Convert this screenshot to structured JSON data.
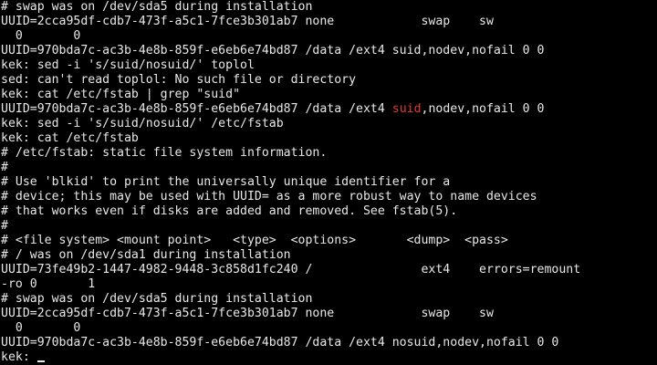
{
  "terminal": {
    "colors": {
      "background": "#000000",
      "foreground": "#e8e8e8",
      "highlight": "#e03a2e"
    },
    "lines": [
      {
        "segments": [
          {
            "text": "# swap was on /dev/sda5 during installation",
            "style": "normal"
          }
        ]
      },
      {
        "segments": [
          {
            "text": "UUID=2cca95df-cdb7-473f-a5c1-7fce3b301ab7 none            swap    sw",
            "style": "normal"
          }
        ]
      },
      {
        "segments": [
          {
            "text": "  0       0",
            "style": "normal"
          }
        ]
      },
      {
        "segments": [
          {
            "text": "UUID=970bda7c-ac3b-4e8b-859f-e6eb6e74bd87 /data /ext4 suid,nodev,nofail 0 0",
            "style": "normal"
          }
        ]
      },
      {
        "segments": [
          {
            "text": "kek: sed -i 's/suid/nosuid/' toplol",
            "style": "normal"
          }
        ]
      },
      {
        "segments": [
          {
            "text": "sed: can't read toplol: No such file or directory",
            "style": "normal"
          }
        ]
      },
      {
        "segments": [
          {
            "text": "kek: cat /etc/fstab | grep \"suid\"",
            "style": "normal"
          }
        ]
      },
      {
        "segments": [
          {
            "text": "UUID=970bda7c-ac3b-4e8b-859f-e6eb6e74bd87 /data /ext4 ",
            "style": "normal"
          },
          {
            "text": "suid",
            "style": "red"
          },
          {
            "text": ",nodev,nofail 0 0",
            "style": "normal"
          }
        ]
      },
      {
        "segments": [
          {
            "text": "kek: sed -i 's/suid/nosuid/' /etc/fstab",
            "style": "normal"
          }
        ]
      },
      {
        "segments": [
          {
            "text": "kek: cat /etc/fstab",
            "style": "normal"
          }
        ]
      },
      {
        "segments": [
          {
            "text": "# /etc/fstab: static file system information.",
            "style": "normal"
          }
        ]
      },
      {
        "segments": [
          {
            "text": "#",
            "style": "normal"
          }
        ]
      },
      {
        "segments": [
          {
            "text": "# Use 'blkid' to print the universally unique identifier for a",
            "style": "normal"
          }
        ]
      },
      {
        "segments": [
          {
            "text": "# device; this may be used with UUID= as a more robust way to name devices",
            "style": "normal"
          }
        ]
      },
      {
        "segments": [
          {
            "text": "# that works even if disks are added and removed. See fstab(5).",
            "style": "normal"
          }
        ]
      },
      {
        "segments": [
          {
            "text": "#",
            "style": "normal"
          }
        ]
      },
      {
        "segments": [
          {
            "text": "# <file system> <mount point>   <type>  <options>       <dump>  <pass>",
            "style": "normal"
          }
        ]
      },
      {
        "segments": [
          {
            "text": "# / was on /dev/sda1 during installation",
            "style": "normal"
          }
        ]
      },
      {
        "segments": [
          {
            "text": "UUID=73fe49b2-1447-4982-9448-3c858d1fc240 /               ext4    errors=remount",
            "style": "normal"
          }
        ]
      },
      {
        "segments": [
          {
            "text": "-ro 0       1",
            "style": "normal"
          }
        ]
      },
      {
        "segments": [
          {
            "text": "# swap was on /dev/sda5 during installation",
            "style": "normal"
          }
        ]
      },
      {
        "segments": [
          {
            "text": "UUID=2cca95df-cdb7-473f-a5c1-7fce3b301ab7 none            swap    sw",
            "style": "normal"
          }
        ]
      },
      {
        "segments": [
          {
            "text": "  0       0",
            "style": "normal"
          }
        ]
      },
      {
        "segments": [
          {
            "text": "UUID=970bda7c-ac3b-4e8b-859f-e6eb6e74bd87 /data /ext4 nosuid,nodev,nofail 0 0",
            "style": "normal"
          }
        ]
      }
    ],
    "prompt": "kek: "
  }
}
